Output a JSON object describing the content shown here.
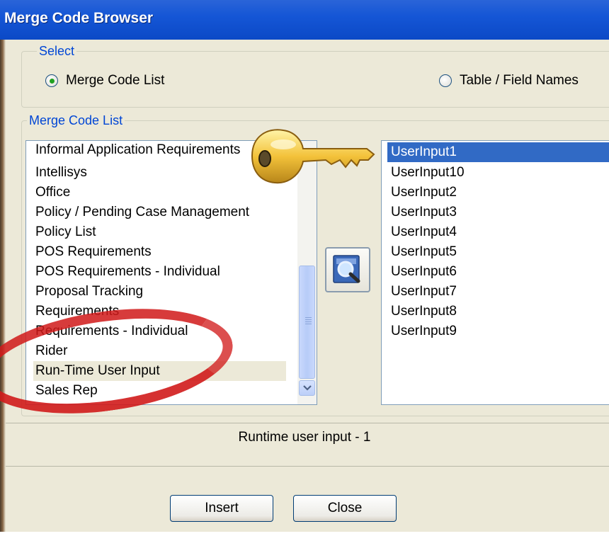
{
  "window": {
    "title": "Merge Code Browser"
  },
  "select_group": {
    "label": "Select",
    "options": [
      {
        "label": "Merge Code List",
        "checked": true
      },
      {
        "label": "Table / Field Names",
        "checked": false
      }
    ]
  },
  "merge_group": {
    "label": "Merge Code List"
  },
  "categories": {
    "items": [
      "Informal Application Requirements",
      "Intellisys",
      "Office",
      "Policy / Pending Case Management",
      "Policy List",
      "POS Requirements",
      "POS Requirements - Individual",
      "Proposal Tracking",
      "Requirements",
      "Requirements - Individual",
      "Rider",
      "Run-Time User Input",
      "Sales Rep"
    ],
    "selected": "Run-Time User Input"
  },
  "codes": {
    "items": [
      "UserInput1",
      "UserInput10",
      "UserInput2",
      "UserInput3",
      "UserInput4",
      "UserInput5",
      "UserInput6",
      "UserInput7",
      "UserInput8",
      "UserInput9"
    ],
    "selected": "UserInput1"
  },
  "status": {
    "text": "Runtime user input - 1"
  },
  "buttons": {
    "insert": "Insert",
    "close": "Close"
  },
  "icons": {
    "search_button": "magnifier-icon",
    "key_overlay": "key-icon",
    "scroll_down": "chevron-down-icon"
  },
  "colors": {
    "titlebar": "#0b49c6",
    "selection": "#316ac5",
    "group_label": "#0046d5",
    "highlight_oval": "#d11b1b",
    "dialog_bg": "#ece9d8"
  }
}
